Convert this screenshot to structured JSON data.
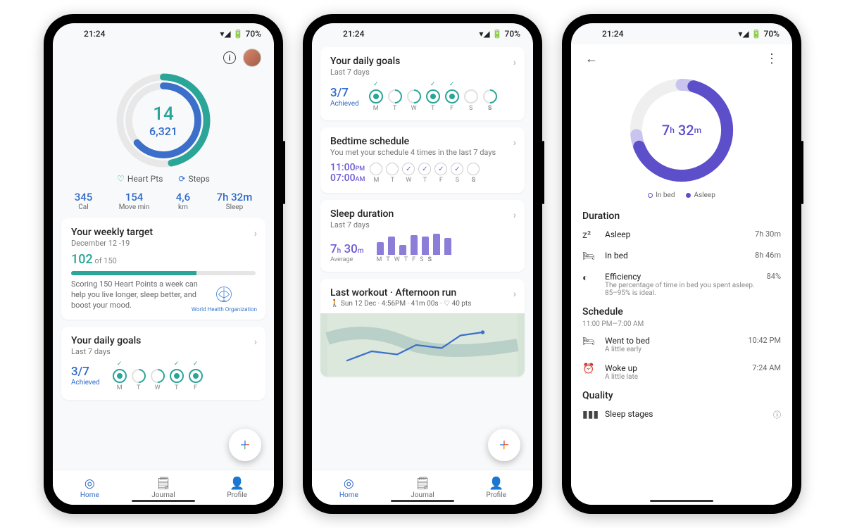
{
  "status": {
    "time": "21:24",
    "battery": "70%"
  },
  "nav": {
    "home": "Home",
    "journal": "Journal",
    "profile": "Profile"
  },
  "s1": {
    "heart_points": "14",
    "steps": "6,321",
    "legend_hp": "Heart Pts",
    "legend_steps": "Steps",
    "stats": {
      "cal_v": "345",
      "cal_l": "Cal",
      "move_v": "154",
      "move_l": "Move min",
      "km_v": "4,6",
      "km_l": "km",
      "sleep_v": "7h 32m",
      "sleep_l": "Sleep"
    },
    "weekly": {
      "title": "Your weekly target",
      "date": "December 12 -19",
      "val": "102",
      "of": " of 150",
      "desc": "Scoring 150 Heart Points a week can help you live longer, sleep better, and boost your mood.",
      "who": "World Health Organization",
      "progress_pct": 68
    },
    "daily": {
      "title": "Your daily goals",
      "sub": "Last 7 days",
      "val": "3/7",
      "achieved": "Achieved",
      "days": [
        "M",
        "T",
        "W",
        "T",
        "F"
      ]
    }
  },
  "s2": {
    "daily": {
      "title": "Your daily goals",
      "sub": "Last 7 days",
      "val": "3/7",
      "achieved": "Achieved",
      "days": [
        "M",
        "T",
        "W",
        "T",
        "F",
        "S",
        "S"
      ]
    },
    "bedtime": {
      "title": "Bedtime schedule",
      "sub": "You met your schedule 4 times in the last 7 days",
      "t1": "11:00",
      "t1p": "PM",
      "t2": "07:00",
      "t2p": "AM",
      "days": [
        "M",
        "T",
        "W",
        "T",
        "F",
        "S",
        "S"
      ]
    },
    "sleep": {
      "title": "Sleep duration",
      "sub": "Last 7 days",
      "val_h": "7",
      "val_m": "30",
      "avg": "Average",
      "days": [
        "M",
        "T",
        "W",
        "T",
        "F",
        "S",
        "S"
      ],
      "bars": [
        18,
        26,
        14,
        28,
        26,
        30,
        24
      ]
    },
    "workout": {
      "title": "Last workout · Afternoon run",
      "meta": "🚶 Sun 12 Dec · 4:56PM · 41m 00s · ♡ 40 pts"
    }
  },
  "s3": {
    "time_h": "7",
    "time_m": "32",
    "leg_inbed": "In bed",
    "leg_asleep": "Asleep",
    "duration": {
      "title": "Duration",
      "asleep_l": "Asleep",
      "asleep_v": "7h 30m",
      "inbed_l": "In bed",
      "inbed_v": "8h 46m",
      "eff_l": "Efficiency",
      "eff_v": "84%",
      "eff_sub": "The percentage of time in bed you spent asleep. 85–95% is ideal."
    },
    "schedule": {
      "title": "Schedule",
      "sub": "11:00 PM—7:00 AM",
      "bed_l": "Went to bed",
      "bed_s": "A little early",
      "bed_v": "10:42 PM",
      "woke_l": "Woke up",
      "woke_s": "A little late",
      "woke_v": "7:24 AM"
    },
    "quality": {
      "title": "Quality",
      "stages": "Sleep stages"
    }
  },
  "chart_data": [
    {
      "type": "pie",
      "title": "Activity rings",
      "series": [
        {
          "name": "Heart Points",
          "values": [
            14
          ],
          "max": 30,
          "color": "#2aa597"
        },
        {
          "name": "Steps",
          "values": [
            6321
          ],
          "max": 10000,
          "color": "#3b6fc9"
        }
      ]
    },
    {
      "type": "bar",
      "title": "Sleep duration (h)",
      "categories": [
        "M",
        "T",
        "W",
        "T",
        "F",
        "S",
        "S"
      ],
      "values": [
        5.5,
        7.0,
        4.5,
        7.5,
        7.0,
        8.0,
        6.5
      ],
      "average": 7.5
    },
    {
      "type": "pie",
      "title": "Sleep dial",
      "series": [
        {
          "name": "Asleep",
          "values": [
            7.5
          ],
          "color": "#5d4fc9"
        },
        {
          "name": "In bed",
          "values": [
            8.77
          ],
          "color": "#c9c4ef"
        }
      ]
    }
  ]
}
